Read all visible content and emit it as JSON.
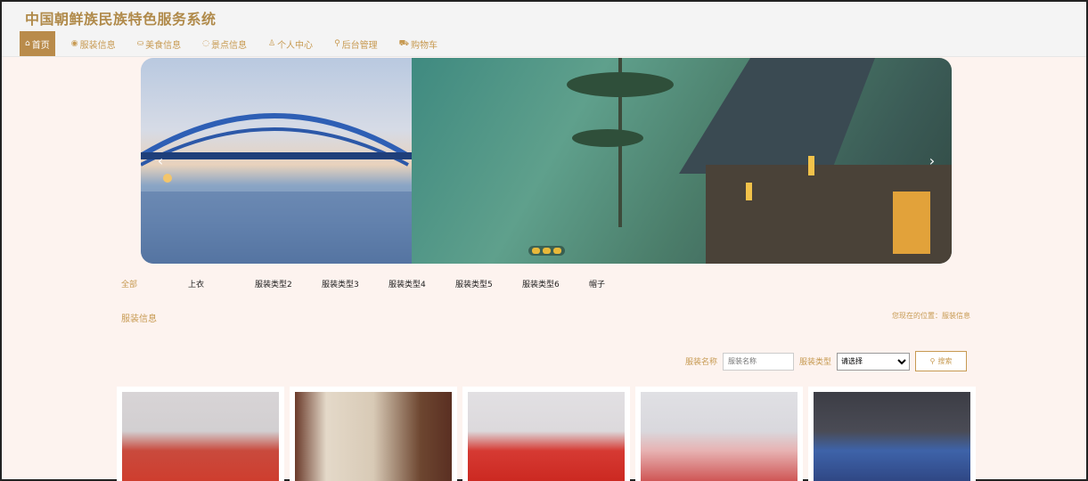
{
  "site": {
    "title": "中国朝鲜族民族特色服务系统"
  },
  "nav": {
    "items": [
      {
        "icon": "⌂",
        "label": "首页"
      },
      {
        "icon": "◉",
        "label": "服装信息"
      },
      {
        "icon": "⛀",
        "label": "美食信息"
      },
      {
        "icon": "◌",
        "label": "景点信息"
      },
      {
        "icon": "♙",
        "label": "个人中心"
      },
      {
        "icon": "⚲",
        "label": "后台管理"
      },
      {
        "icon": "⛟",
        "label": "购物车"
      }
    ],
    "active_index": 0
  },
  "carousel": {
    "prev": "‹",
    "next": "›",
    "slides": 3
  },
  "categories": [
    "全部",
    "上衣",
    "服装类型2",
    "服装类型3",
    "服装类型4",
    "服装类型5",
    "服装类型6",
    "帽子"
  ],
  "section": {
    "title": "服装信息",
    "breadcrumb": "您现在的位置：服装信息"
  },
  "search": {
    "name_label": "服装名称",
    "name_placeholder": "服装名称",
    "type_label": "服装类型",
    "type_selected": "请选择",
    "button": "搜索"
  },
  "colors": {
    "accent": "#c79a52",
    "active_nav": "#b98b4b",
    "page_bg": "#fdf3ef"
  }
}
